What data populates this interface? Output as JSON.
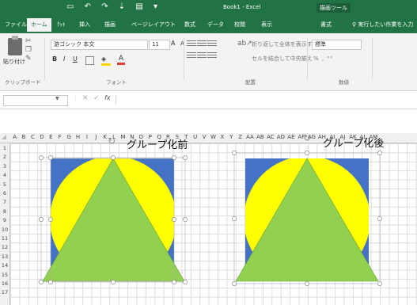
{
  "titlebar": {
    "qat_icons": [
      "save-icon",
      "undo-icon",
      "redo-icon",
      "format-icon",
      "print-preview-icon",
      "customize-icon"
    ],
    "qat_glyphs": [
      "▭",
      "↶",
      "↷",
      "⇣",
      "▤",
      "▾"
    ],
    "title": "Book1 - Excel",
    "contextual_label": "描画ツール"
  },
  "tabs": [
    {
      "label": "ファイル",
      "active": false
    },
    {
      "label": "ホーム",
      "active": true
    },
    {
      "label": "ｸｯﾄ",
      "active": false
    },
    {
      "label": "挿入",
      "active": false
    },
    {
      "label": "描画",
      "active": false
    },
    {
      "label": "ページレイアウト",
      "active": false
    },
    {
      "label": "数式",
      "active": false
    },
    {
      "label": "データ",
      "active": false
    },
    {
      "label": "校閲",
      "active": false
    },
    {
      "label": "表示",
      "active": false
    },
    {
      "label": "書式",
      "active": false
    }
  ],
  "tell_me": "♀ 実行したい作業を入力",
  "ribbon": {
    "paste_label": "貼り付け",
    "font_name": "游ゴシック 本文",
    "font_size": "11",
    "grow_label": "A",
    "shrink_label": "A",
    "bold_label": "B",
    "italic_label": "I",
    "underline_label": "U",
    "font_color_label": "A",
    "wrap_text_label": "折り返して全体を表示する",
    "merge_center_label": "セルを結合して中央揃え",
    "number_format": "標準",
    "number_row": "%  ,  ⁰⁰",
    "group_clipboard": "クリップボード",
    "group_font": "フォント",
    "group_alignment": "配置",
    "group_number": "数値",
    "accent_color": "#217346"
  },
  "formula_bar": {
    "fx_label": "fx",
    "cancel_label": "✕",
    "enter_label": "✓",
    "dots_label": "⋮"
  },
  "sheet": {
    "columns": [
      "A",
      "B",
      "C",
      "D",
      "E",
      "F",
      "G",
      "H",
      "I",
      "J",
      "K",
      "L",
      "M",
      "N",
      "O",
      "P",
      "Q",
      "R",
      "S",
      "T",
      "U",
      "V",
      "W",
      "X",
      "Y",
      "Z",
      "AA",
      "AB",
      "AC",
      "AD",
      "AE",
      "AF",
      "AG",
      "AH",
      "AI",
      "AJ",
      "AK",
      "AL",
      "AM"
    ],
    "rows": [
      "1",
      "2",
      "3",
      "4",
      "5",
      "6",
      "7",
      "8",
      "9",
      "10",
      "11",
      "12",
      "13",
      "14",
      "15",
      "16",
      "17"
    ]
  },
  "shapes": {
    "label_before": "グループ化前",
    "label_after": "グループ化後",
    "rect_color": "#4472c4",
    "circle_color": "#ffff00",
    "triangle_color": "#92d050"
  }
}
